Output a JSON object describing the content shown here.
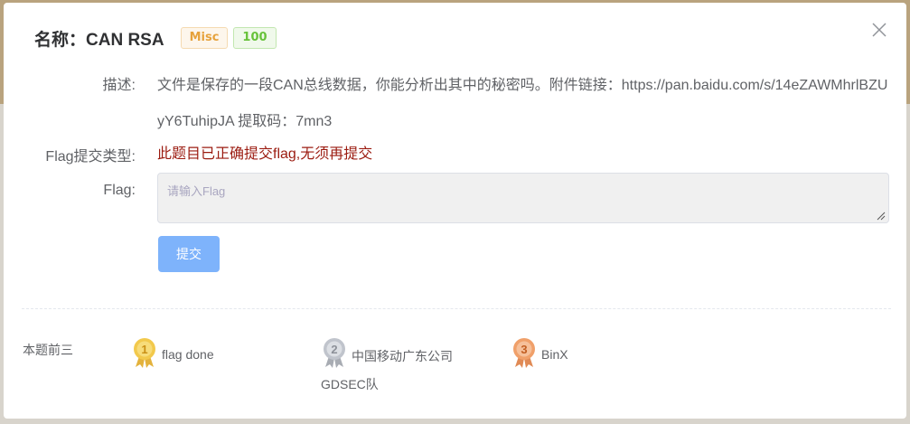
{
  "dialog": {
    "title": "名称：CAN RSA",
    "category_tag": "Misc",
    "score_tag": "100",
    "close_icon": "close-icon"
  },
  "form": {
    "description_label": "描述:",
    "description_text": "文件是保存的一段CAN总线数据，你能分析出其中的秘密吗。附件链接：https://pan.baidu.com/s/14eZAWMhrlBZUyY6TuhipJA 提取码：7mn3",
    "flag_type_label": "Flag提交类型:",
    "flag_status": "此题目已正确提交flag,无须再提交",
    "flag_label": "Flag:",
    "flag_value": "",
    "flag_placeholder": "请输入Flag",
    "submit_label": "提交"
  },
  "top3": {
    "label": "本题前三",
    "ranks": [
      {
        "number": "1",
        "name": "flag done",
        "medal_color": "#f2c94c"
      },
      {
        "number": "2",
        "name_line1": "中国移动广东公司",
        "name_line2": "GDSEC队",
        "medal_color": "#c0c4cc"
      },
      {
        "number": "3",
        "name": "BinX",
        "medal_color": "#f0a06a"
      }
    ]
  },
  "colors": {
    "status_text": "#9b1b10",
    "submit_button": "#7eb3fb",
    "misc_tag": "#e6a23c",
    "score_tag": "#67c23a"
  }
}
